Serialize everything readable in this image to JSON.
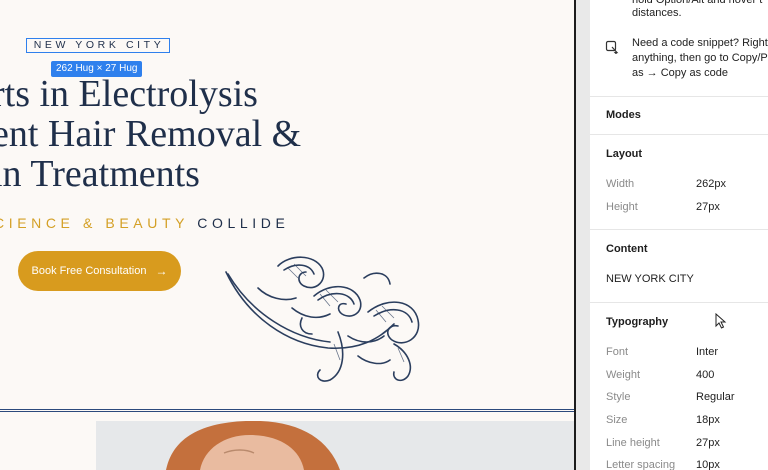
{
  "canvas": {
    "city_text": "NEW YORK CITY",
    "hug_badge": "262 Hug × 27 Hug",
    "headline": [
      "rts in Electrolysis",
      "ent Hair Removal &",
      "in Treatments"
    ],
    "tagline_gold": "CIENCE & BEAUTY",
    "tagline_navy": "COLLIDE",
    "cta_label": "Book Free Consultation",
    "cta_arrow": "→"
  },
  "panel": {
    "tip_top": [
      "hold Option/Alt and hover t",
      "distances."
    ],
    "tip_code": [
      "Need a code snippet? Right",
      "anything, then go to Copy/P",
      "as → Copy as code"
    ],
    "sections": {
      "modes": "Modes",
      "layout": "Layout",
      "content": "Content",
      "typography": "Typography"
    },
    "layout": [
      {
        "label": "Width",
        "value": "262px"
      },
      {
        "label": "Height",
        "value": "27px"
      }
    ],
    "content_value": "NEW YORK CITY",
    "typography": [
      {
        "label": "Font",
        "value": "Inter"
      },
      {
        "label": "Weight",
        "value": "400"
      },
      {
        "label": "Style",
        "value": "Regular"
      },
      {
        "label": "Size",
        "value": "18px"
      },
      {
        "label": "Line height",
        "value": "27px"
      },
      {
        "label": "Letter spacing",
        "value": "10px"
      }
    ]
  },
  "colors": {
    "selection": "#2f80ed",
    "gold": "#d89b1e",
    "navy": "#1f2f4a",
    "canvas_bg": "#fcf9f6"
  }
}
